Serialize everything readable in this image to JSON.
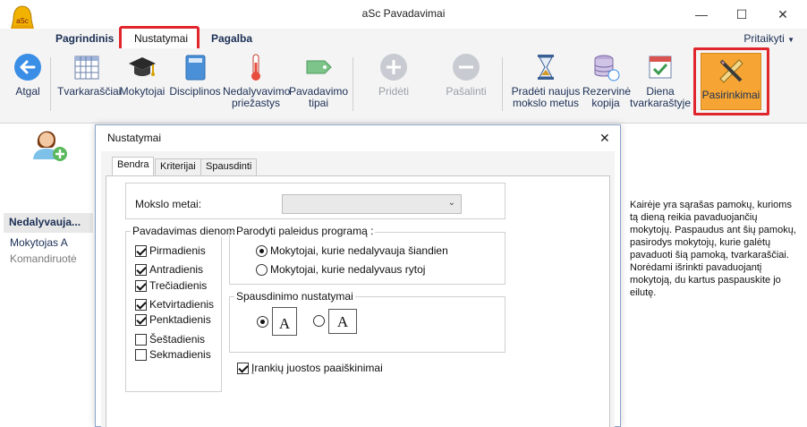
{
  "window": {
    "title": "aSc Pavadavimai",
    "minimize_icon": "minimize-icon",
    "maximize_icon": "maximize-icon",
    "close_icon": "close-icon"
  },
  "menu": {
    "tabs": [
      "Pagrindinis",
      "Nustatymai",
      "Pagalba"
    ],
    "active_tab": "Nustatymai",
    "customize_label": "Pritaikyti",
    "customize_icon": "chevron-down-icon"
  },
  "ribbon": {
    "back": {
      "label": "Atgal",
      "icon": "back-arrow-icon"
    },
    "timetables": {
      "label": "Tvarkaraščiai",
      "icon": "grid-table-icon"
    },
    "teachers": {
      "label": "Mokytojai",
      "icon": "graduation-cap-icon"
    },
    "subjects": {
      "label": "Disciplinos",
      "icon": "book-icon"
    },
    "absence_reason": {
      "label1": "Nedalyvavimo",
      "label2": "priežastys",
      "icon": "thermometer-icon"
    },
    "substitution_types": {
      "label1": "Pavadavimo",
      "label2": "tipai",
      "icon": "tag-icon"
    },
    "add": {
      "label": "Pridėti",
      "icon": "plus-icon",
      "disabled": true
    },
    "remove": {
      "label": "Pašalinti",
      "icon": "minus-icon",
      "disabled": true
    },
    "new_year": {
      "label1": "Pradėti naujus",
      "label2": "mokslo metus",
      "icon": "hourglass-icon"
    },
    "backup": {
      "label1": "Rezervinė",
      "label2": "kopija",
      "icon": "database-icon"
    },
    "day_timetable": {
      "label1": "Diena",
      "label2": "tvarkaraštyje",
      "icon": "calendar-check-icon"
    },
    "options": {
      "label": "Pasirinkimai",
      "icon": "pencil-ruler-icon"
    }
  },
  "left_panel": {
    "avatar_icon": "add-user-avatar-icon",
    "header": "Nedalyvauja...",
    "items": [
      "Mokytojas A",
      "Komandiruotė"
    ]
  },
  "help_text": "Kairėje yra sąrašas pamokų, kurioms tą dieną reikia pavaduojančių mokytojų. Paspaudus ant šių pamokų, pasirodys mokytojų, kurie galėtų pavaduoti šią pamoką, tvarkaraščiai. Norėdami išrinkti pavaduojantį mokytoją, du kartus paspauskite jo eilutę.",
  "dialog": {
    "title": "Nustatymai",
    "tabs": [
      "Bendra",
      "Kriterijai",
      "Spausdinti"
    ],
    "active_tab": "Bendra",
    "school_year_label": "Mokslo metai:",
    "school_year_value": "",
    "days_group_label": "Pavadavimas dienoms",
    "days": [
      {
        "label": "Pirmadienis",
        "checked": true
      },
      {
        "label": "Antradienis",
        "checked": true
      },
      {
        "label": "Trečiadienis",
        "checked": true
      },
      {
        "label": "Ketvirtadienis",
        "checked": true
      },
      {
        "label": "Penktadienis",
        "checked": true
      },
      {
        "label": "Šeštadienis",
        "checked": false
      },
      {
        "label": "Sekmadienis",
        "checked": false
      }
    ],
    "startup_group_label": "Parodyti paleidus programą :",
    "startup_options": [
      {
        "label": "Mokytojai, kurie nedalyvauja šiandien",
        "selected": true
      },
      {
        "label": "Mokytojai, kurie nedalyvaus rytoj",
        "selected": false
      }
    ],
    "print_group_label": "Spausdinimo nustatymai",
    "print_options": [
      {
        "glyph": "A",
        "orientation": "portrait",
        "selected": true
      },
      {
        "glyph": "A",
        "orientation": "landscape",
        "selected": false
      }
    ],
    "toolbar_tips": {
      "label": "Įrankių juostos paaiškinimai",
      "checked": true
    }
  }
}
